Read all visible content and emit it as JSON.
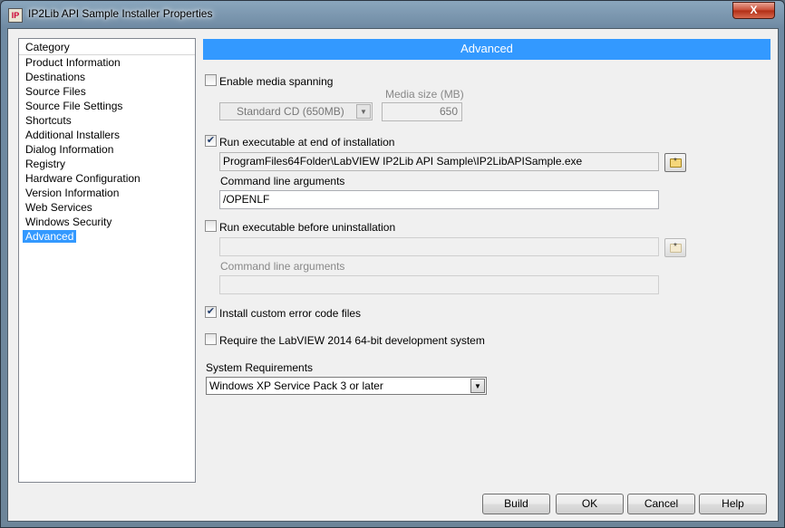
{
  "window": {
    "title": "IP2Lib API Sample Installer Properties",
    "close_label": "X"
  },
  "sidebar": {
    "header": "Category",
    "items": [
      {
        "label": "Product Information",
        "selected": false
      },
      {
        "label": "Destinations",
        "selected": false
      },
      {
        "label": "Source Files",
        "selected": false
      },
      {
        "label": "Source File Settings",
        "selected": false
      },
      {
        "label": "Shortcuts",
        "selected": false
      },
      {
        "label": "Additional Installers",
        "selected": false
      },
      {
        "label": "Dialog Information",
        "selected": false
      },
      {
        "label": "Registry",
        "selected": false
      },
      {
        "label": "Hardware Configuration",
        "selected": false
      },
      {
        "label": "Version Information",
        "selected": false
      },
      {
        "label": "Web Services",
        "selected": false
      },
      {
        "label": "Windows Security",
        "selected": false
      },
      {
        "label": "Advanced",
        "selected": true
      }
    ]
  },
  "main": {
    "header": "Advanced",
    "media_spanning": {
      "label": "Enable media spanning",
      "checked": false,
      "media_type": "Standard CD (650MB)",
      "media_size_label": "Media size (MB)",
      "media_size": "650"
    },
    "run_at_end": {
      "label": "Run executable at end of installation",
      "checked": true,
      "path": "ProgramFiles64Folder\\LabVIEW IP2Lib API Sample\\IP2LibAPISample.exe",
      "args_label": "Command line arguments",
      "args": "/OPENLF"
    },
    "run_before_uninstall": {
      "label": "Run executable before uninstallation",
      "checked": false,
      "path": "",
      "args_label": "Command line arguments",
      "args": ""
    },
    "custom_error_codes": {
      "label": "Install custom error code files",
      "checked": true
    },
    "require_64bit": {
      "label": "Require the LabVIEW 2014 64-bit development system",
      "checked": false
    },
    "system_requirements": {
      "label": "System Requirements",
      "value": "Windows XP Service Pack 3 or later"
    }
  },
  "buttons": {
    "build": "Build",
    "ok": "OK",
    "cancel": "Cancel",
    "help": "Help"
  },
  "icons": {
    "app": "installer-app-icon",
    "close": "close-icon",
    "browse": "folder-browse-icon",
    "checkbox_checked": "check-icon",
    "dropdown": "chevron-down-icon"
  },
  "colors": {
    "accent": "#3399ff",
    "close_button": "#c74a33"
  }
}
